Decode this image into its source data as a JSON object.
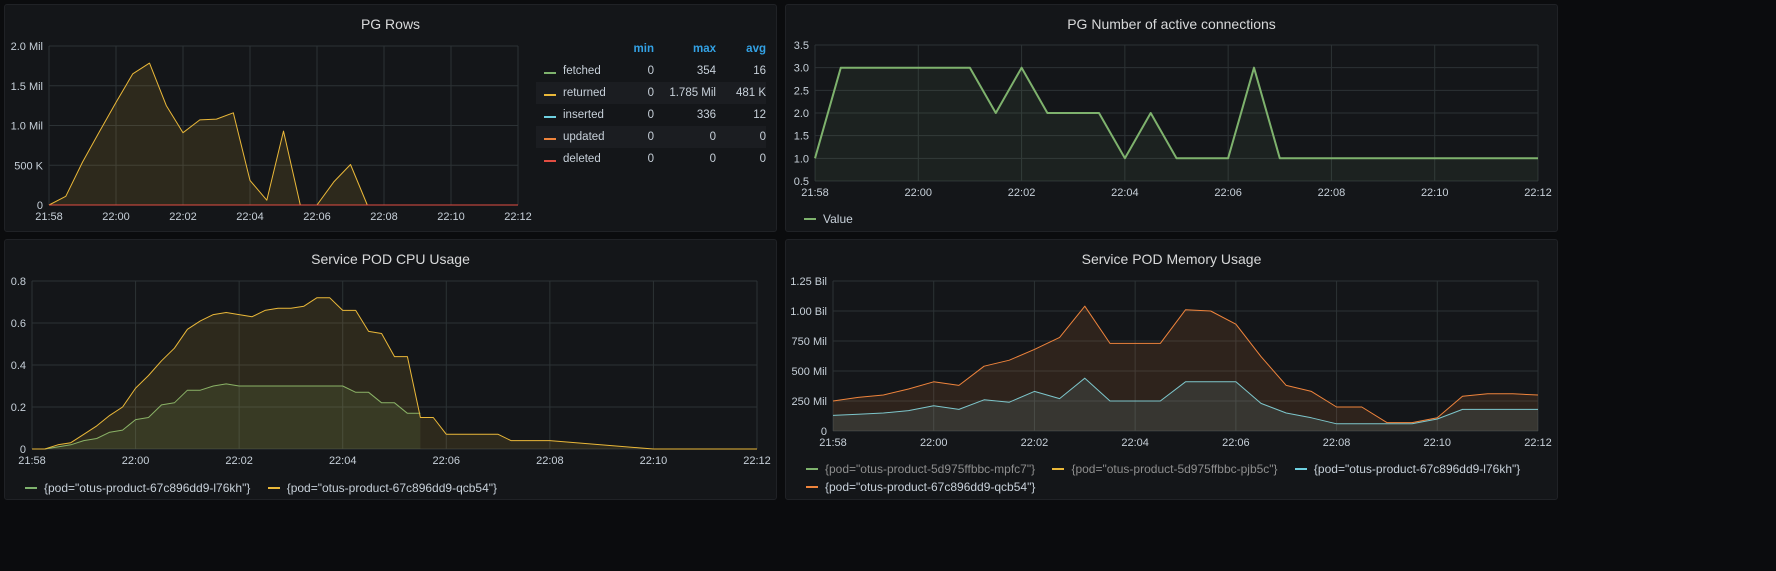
{
  "colors": {
    "green": "#7eb26d",
    "yellow": "#eab839",
    "cyan": "#6ed0e0",
    "orange": "#ef843c",
    "red": "#e24d42"
  },
  "panels": {
    "rows": {
      "title": "PG Rows"
    },
    "connections": {
      "title": "PG Number of active connections"
    },
    "cpu": {
      "title": "Service POD CPU Usage"
    },
    "memory": {
      "title": "Service POD Memory Usage"
    }
  },
  "rows_legend": {
    "headers": [
      "min",
      "max",
      "avg"
    ],
    "rows": [
      {
        "name": "fetched",
        "min": "0",
        "max": "354",
        "avg": "16"
      },
      {
        "name": "returned",
        "min": "0",
        "max": "1.785 Mil",
        "avg": "481 K"
      },
      {
        "name": "inserted",
        "min": "0",
        "max": "336",
        "avg": "12"
      },
      {
        "name": "updated",
        "min": "0",
        "max": "0",
        "avg": "0"
      },
      {
        "name": "deleted",
        "min": "0",
        "max": "0",
        "avg": "0"
      }
    ]
  },
  "chart_data": [
    {
      "type": "area",
      "title": "PG Rows",
      "x_ticks": [
        "21:58",
        "22:00",
        "22:02",
        "22:04",
        "22:06",
        "22:08",
        "22:10",
        "22:12"
      ],
      "y_ticks": [
        "0",
        "500 K",
        "1.0 Mil",
        "1.5 Mil",
        "2.0 Mil"
      ],
      "ylim": [
        0,
        2000000
      ],
      "xlim": [
        "21:58",
        "22:12"
      ],
      "series": [
        {
          "name": "fetched",
          "color": "#7eb26d",
          "x": [
            "21:58",
            "22:12"
          ],
          "values": [
            0,
            0
          ]
        },
        {
          "name": "returned",
          "color": "#eab839",
          "x": [
            "21:58",
            "21:58:30",
            "21:59",
            "21:59:30",
            "22:00",
            "22:00:30",
            "22:01",
            "22:01:30",
            "22:02",
            "22:02:30",
            "22:03",
            "22:03:30",
            "22:04",
            "22:04:30",
            "22:05",
            "22:05:30",
            "22:06",
            "22:06:30",
            "22:07",
            "22:07:30",
            "22:08",
            "22:12"
          ],
          "values": [
            0,
            110000,
            540000,
            920000,
            1290000,
            1650000,
            1785000,
            1250000,
            910000,
            1070000,
            1080000,
            1160000,
            310000,
            60000,
            930000,
            0,
            0,
            290000,
            510000,
            0,
            0,
            0
          ]
        },
        {
          "name": "inserted",
          "color": "#6ed0e0",
          "x": [
            "21:58",
            "22:12"
          ],
          "values": [
            0,
            0
          ]
        },
        {
          "name": "updated",
          "color": "#ef843c",
          "x": [
            "21:58",
            "22:12"
          ],
          "values": [
            0,
            0
          ]
        },
        {
          "name": "deleted",
          "color": "#e24d42",
          "x": [
            "21:58",
            "22:12"
          ],
          "values": [
            0,
            0
          ]
        }
      ],
      "legend": "right"
    },
    {
      "type": "line",
      "title": "PG Number of active connections",
      "x_ticks": [
        "21:58",
        "22:00",
        "22:02",
        "22:04",
        "22:06",
        "22:08",
        "22:10",
        "22:12"
      ],
      "y_ticks": [
        "0.5",
        "1.0",
        "1.5",
        "2.0",
        "2.5",
        "3.0",
        "3.5"
      ],
      "ylim": [
        0.5,
        3.5
      ],
      "xlim": [
        "21:58",
        "22:12"
      ],
      "series": [
        {
          "name": "Value",
          "color": "#7eb26d",
          "x": [
            "21:58",
            "21:58:30",
            "22:01",
            "22:01:30",
            "22:02",
            "22:02:30",
            "22:03:30",
            "22:04",
            "22:04:30",
            "22:05",
            "22:06",
            "22:06:30",
            "22:07",
            "22:12"
          ],
          "values": [
            1,
            3,
            3,
            2,
            3,
            2,
            2,
            1,
            2,
            1,
            1,
            3,
            1,
            1
          ]
        }
      ],
      "legend": "bottom"
    },
    {
      "type": "area",
      "title": "Service POD CPU Usage",
      "x_ticks": [
        "21:58",
        "22:00",
        "22:02",
        "22:04",
        "22:06",
        "22:08",
        "22:10",
        "22:12"
      ],
      "y_ticks": [
        "0",
        "0.2",
        "0.4",
        "0.6",
        "0.8"
      ],
      "ylim": [
        0,
        0.8
      ],
      "xlim": [
        "21:58",
        "22:12"
      ],
      "series": [
        {
          "name": "{pod=\"otus-product-67c896dd9-l76kh\"}",
          "color": "#7eb26d",
          "x": [
            "21:58",
            "21:58:15",
            "21:58:30",
            "21:58:45",
            "21:59",
            "21:59:15",
            "21:59:30",
            "21:59:45",
            "22:00",
            "22:00:15",
            "22:00:30",
            "22:00:45",
            "22:01",
            "22:01:15",
            "22:01:30",
            "22:01:45",
            "22:02",
            "22:02:15",
            "22:02:30",
            "22:02:45",
            "22:03",
            "22:03:15",
            "22:03:30",
            "22:03:45",
            "22:04",
            "22:04:15",
            "22:04:30",
            "22:04:45",
            "22:05",
            "22:05:15",
            "22:05:30"
          ],
          "values": [
            0,
            0,
            0.01,
            0.02,
            0.04,
            0.05,
            0.08,
            0.09,
            0.14,
            0.15,
            0.21,
            0.22,
            0.28,
            0.28,
            0.3,
            0.31,
            0.3,
            0.3,
            0.3,
            0.3,
            0.3,
            0.3,
            0.3,
            0.3,
            0.3,
            0.27,
            0.27,
            0.22,
            0.22,
            0.17,
            0.17
          ]
        },
        {
          "name": "{pod=\"otus-product-67c896dd9-qcb54\"}",
          "color": "#eab839",
          "x": [
            "21:58",
            "21:58:15",
            "21:58:30",
            "21:58:45",
            "21:59",
            "21:59:15",
            "21:59:30",
            "21:59:45",
            "22:00",
            "22:00:15",
            "22:00:30",
            "22:00:45",
            "22:01",
            "22:01:15",
            "22:01:30",
            "22:01:45",
            "22:02",
            "22:02:15",
            "22:02:30",
            "22:02:45",
            "22:03",
            "22:03:15",
            "22:03:30",
            "22:03:45",
            "22:04",
            "22:04:15",
            "22:04:30",
            "22:04:45",
            "22:05",
            "22:05:15",
            "22:05:30",
            "22:05:45",
            "22:06",
            "22:06:15",
            "22:06:30",
            "22:06:45",
            "22:07",
            "22:07:15",
            "22:07:30",
            "22:07:45",
            "22:08",
            "22:10",
            "22:10:15",
            "22:12"
          ],
          "values": [
            0,
            0,
            0.02,
            0.03,
            0.07,
            0.11,
            0.16,
            0.2,
            0.29,
            0.35,
            0.42,
            0.48,
            0.57,
            0.61,
            0.64,
            0.65,
            0.64,
            0.63,
            0.66,
            0.67,
            0.67,
            0.68,
            0.72,
            0.72,
            0.66,
            0.66,
            0.56,
            0.55,
            0.44,
            0.44,
            0.15,
            0.15,
            0.07,
            0.07,
            0.07,
            0.07,
            0.07,
            0.04,
            0.04,
            0.04,
            0.04,
            0,
            0,
            0
          ]
        }
      ],
      "legend": "bottom"
    },
    {
      "type": "area",
      "title": "Service POD Memory Usage",
      "x_ticks": [
        "21:58",
        "22:00",
        "22:02",
        "22:04",
        "22:06",
        "22:08",
        "22:10",
        "22:12"
      ],
      "y_ticks": [
        "0",
        "250 Mil",
        "500 Mil",
        "750 Mil",
        "1.00 Bil",
        "1.25 Bil"
      ],
      "ylim": [
        0,
        1250000000
      ],
      "xlim": [
        "21:58",
        "22:12"
      ],
      "series": [
        {
          "name": "{pod=\"otus-product-5d975ffbbc-mpfc7\"}",
          "color": "#7eb26d",
          "x": [],
          "values": []
        },
        {
          "name": "{pod=\"otus-product-5d975ffbbc-pjb5c\"}",
          "color": "#eab839",
          "x": [],
          "values": []
        },
        {
          "name": "{pod=\"otus-product-67c896dd9-l76kh\"}",
          "color": "#6ed0e0",
          "x": [
            "21:58",
            "21:58:30",
            "21:59",
            "21:59:30",
            "22:00",
            "22:00:30",
            "22:01",
            "22:01:30",
            "22:02",
            "22:02:30",
            "22:03",
            "22:03:30",
            "22:04",
            "22:04:30",
            "22:05",
            "22:05:30",
            "22:06",
            "22:06:30",
            "22:07",
            "22:07:30",
            "22:08",
            "22:08:30",
            "22:09",
            "22:09:30",
            "22:10",
            "22:10:30",
            "22:11",
            "22:11:30",
            "22:12"
          ],
          "values": [
            130000000,
            140000000,
            150000000,
            170000000,
            210000000,
            180000000,
            260000000,
            240000000,
            330000000,
            270000000,
            440000000,
            250000000,
            250000000,
            250000000,
            410000000,
            410000000,
            410000000,
            230000000,
            150000000,
            110000000,
            60000000,
            60000000,
            60000000,
            60000000,
            100000000,
            180000000,
            180000000,
            180000000,
            180000000
          ]
        },
        {
          "name": "{pod=\"otus-product-67c896dd9-qcb54\"}",
          "color": "#ef843c",
          "x": [
            "21:58",
            "21:58:30",
            "21:59",
            "21:59:30",
            "22:00",
            "22:00:30",
            "22:01",
            "22:01:30",
            "22:02",
            "22:02:30",
            "22:03",
            "22:03:30",
            "22:04",
            "22:04:30",
            "22:05",
            "22:05:30",
            "22:06",
            "22:06:30",
            "22:07",
            "22:07:30",
            "22:08",
            "22:08:30",
            "22:09",
            "22:09:30",
            "22:10",
            "22:10:30",
            "22:11",
            "22:11:30",
            "22:12"
          ],
          "values": [
            250000000,
            280000000,
            300000000,
            350000000,
            410000000,
            380000000,
            540000000,
            590000000,
            680000000,
            780000000,
            1040000000,
            730000000,
            730000000,
            730000000,
            1010000000,
            1000000000,
            890000000,
            620000000,
            380000000,
            330000000,
            200000000,
            200000000,
            70000000,
            70000000,
            110000000,
            290000000,
            310000000,
            310000000,
            300000000
          ]
        }
      ],
      "legend": "bottom"
    }
  ]
}
